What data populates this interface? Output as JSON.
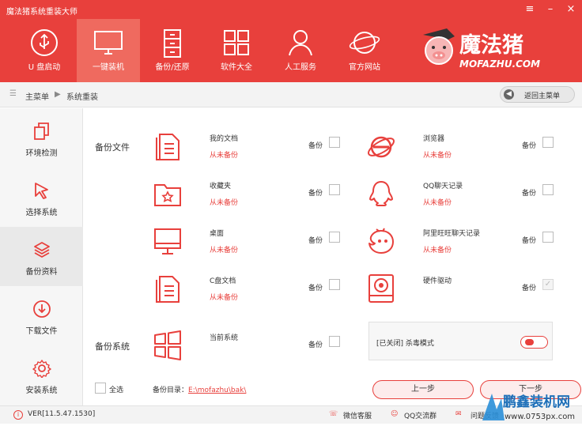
{
  "app": {
    "title": "魔法猪系统重装大师"
  },
  "nav": [
    {
      "label": "U 盘启动",
      "icon": "usb-icon"
    },
    {
      "label": "一键装机",
      "icon": "monitor-icon"
    },
    {
      "label": "备份/还原",
      "icon": "cabinet-icon"
    },
    {
      "label": "软件大全",
      "icon": "grid-icon"
    },
    {
      "label": "人工服务",
      "icon": "person-icon"
    },
    {
      "label": "官方网站",
      "icon": "planet-icon"
    }
  ],
  "logo": {
    "text": "魔法猪",
    "sub": "mofazhu.com"
  },
  "breadcrumb": {
    "home": "主菜单",
    "current": "系统重装",
    "back": "返回主菜单"
  },
  "sidebar": [
    {
      "label": "环境检测"
    },
    {
      "label": "选择系统"
    },
    {
      "label": "备份资料"
    },
    {
      "label": "下载文件"
    },
    {
      "label": "安装系统"
    }
  ],
  "backup": {
    "files_label": "备份文件",
    "system_label": "备份系统",
    "backup_word": "备份",
    "items": [
      {
        "name": "我的文档",
        "status": "从未备份"
      },
      {
        "name": "浏览器",
        "status": "从未备份"
      },
      {
        "name": "收藏夹",
        "status": "从未备份"
      },
      {
        "name": "QQ聊天记录",
        "status": "从未备份"
      },
      {
        "name": "桌面",
        "status": "从未备份"
      },
      {
        "name": "阿里旺旺聊天记录",
        "status": "从未备份"
      },
      {
        "name": "C盘文档",
        "status": "从未备份"
      },
      {
        "name": "硬件驱动",
        "status": ""
      },
      {
        "name": "当前系统",
        "status": ""
      }
    ],
    "antivirus": "[已关闭] 杀毒模式",
    "select_all": "全选",
    "dir_label": "备份目录：",
    "dir_path": "E:\\mofazhu\\bak\\",
    "prev": "上一步",
    "next": "下一步"
  },
  "footer": {
    "version": "VER[11.5.47.1530]",
    "wechat": "微信客服",
    "qq": "QQ交流群",
    "help": "问题反馈"
  },
  "watermark": {
    "brand": "鹏鑫装机网",
    "url": "www.0753px.com"
  },
  "colors": {
    "accent": "#e8403c"
  }
}
